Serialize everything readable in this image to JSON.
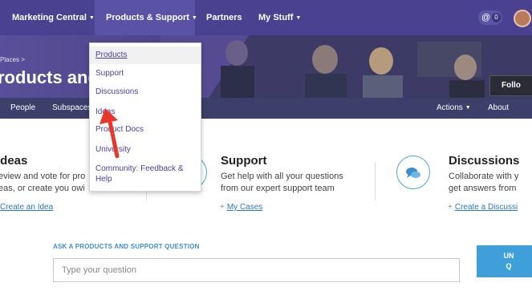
{
  "topnav": {
    "items": [
      {
        "label": "Marketing Central"
      },
      {
        "label": "Products & Support"
      },
      {
        "label": "Partners"
      },
      {
        "label": "My Stuff"
      }
    ],
    "notifications": {
      "at": "@",
      "count": "0"
    }
  },
  "hero": {
    "breadcrumb": "Places >",
    "title": "roducts and Su",
    "follow_label": "Follo"
  },
  "subnav": {
    "left": [
      "People",
      "Subspaces"
    ],
    "actions_label": "Actions",
    "about_label": "About"
  },
  "dropdown": {
    "items": [
      {
        "label": "Products"
      },
      {
        "label": "Support"
      },
      {
        "label": "Discussions"
      },
      {
        "label": "Ideas"
      },
      {
        "label": "Product Docs"
      },
      {
        "label": "University"
      },
      {
        "label": "Community: Feedback &"
      },
      {
        "label": "Help"
      }
    ]
  },
  "cards": [
    {
      "title": "Ideas",
      "text_line1": "eview and vote for pro",
      "text_line2": "eas, or create you owi",
      "link": "Create an Idea"
    },
    {
      "title": "Support",
      "text_line1": "Get help with all your questions",
      "text_line2": "from our expert support team",
      "link_plus": "+",
      "link": "My Cases"
    },
    {
      "title": "Discussions",
      "text_line1": "Collaborate with y",
      "text_line2": "get answers from",
      "link_plus": "+",
      "link": "Create a Discussi"
    }
  ],
  "ask": {
    "label": "ASK A PRODUCTS AND SUPPORT QUESTION",
    "placeholder": "Type your question",
    "cta_line1": "UN",
    "cta_line2": "Q"
  },
  "colors": {
    "nav_bg": "#4a4290",
    "subnav_bg": "#3b3f6a",
    "link": "#2a7ab8",
    "accent_blue": "#3fa0d9",
    "dropdown_text": "#4b3f9a",
    "annotation_arrow": "#e8362b"
  }
}
